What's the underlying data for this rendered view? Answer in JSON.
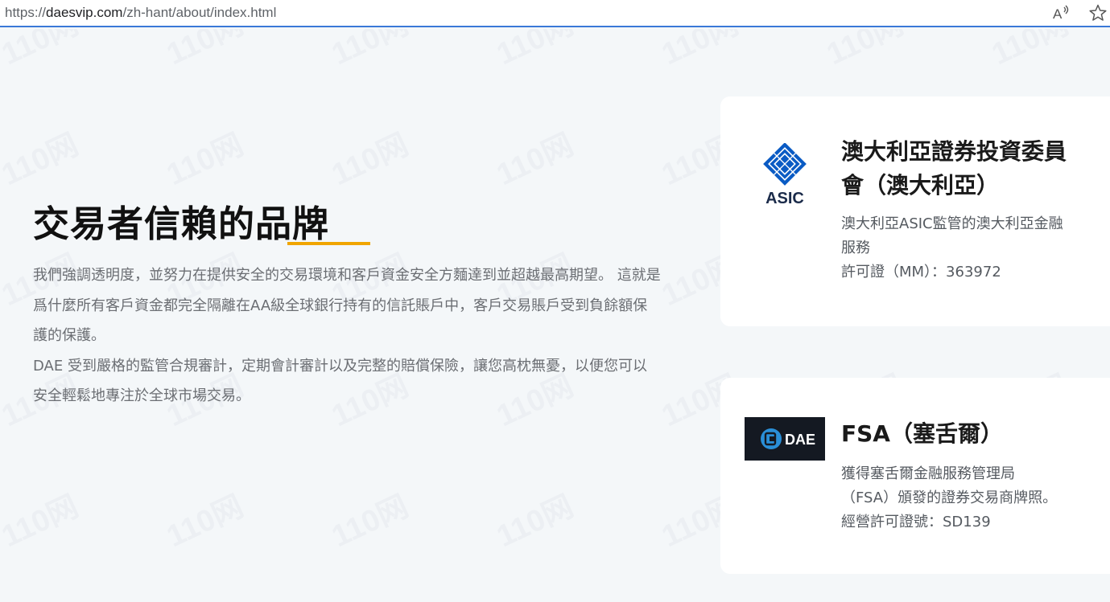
{
  "browser": {
    "url_prefix": "https://",
    "url_domain": "daesvip.com",
    "url_path": "/zh-hant/about/index.html",
    "read_aloud_label": "Aᐧ",
    "favorite_icon": "star-icon"
  },
  "watermark": {
    "text": "110网"
  },
  "about": {
    "heading_main": "交易者信賴的",
    "heading_highlight": "品牌",
    "paragraph_1": "我們強調透明度，並努力在提供安全的交易環境和客戶資金安全方麵達到並超越最高期望。 這就是爲什麼所有客戶資金都完全隔離在AA級全球銀行持有的信託賬戶中，客戶交易賬戶受到負餘額保護的保護。",
    "paragraph_2": "DAE 受到嚴格的監管合規審計，定期會計審計以及完整的賠償保險，讓您高枕無憂，以便您可以安全輕鬆地專注於全球市場交易。"
  },
  "regulators": [
    {
      "title_line_1": "澳大利亞證券投資委員",
      "title_line_2": "會（澳大利亞）",
      "text_line_1": "澳大利亞ASIC監管的澳大利亞金融",
      "text_line_2": "服務",
      "text_line_3": "許可證（MM）：363972",
      "logo_text": "ASIC"
    },
    {
      "title_line_1": "FSA（塞舌爾）",
      "text_line_1": "獲得塞舌爾金融服務管理局",
      "text_line_2": "（FSA）頒發的證券交易商牌照。",
      "text_line_3": "經營許可證號：SD139",
      "logo_text": "DAE"
    }
  ],
  "colors": {
    "accent_underline": "#f0a500",
    "asic_blue": "#0a5bc4",
    "dae_blue": "#2a8fd8",
    "page_bg": "#f4f7f9"
  }
}
